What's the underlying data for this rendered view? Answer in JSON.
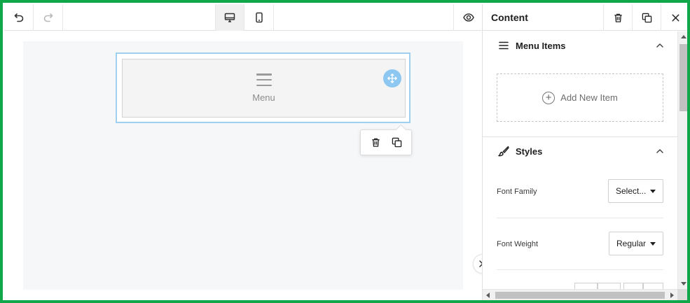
{
  "toolbar": {
    "undo_icon": "undo-icon",
    "redo_icon": "redo-icon",
    "desktop_icon": "desktop-icon",
    "mobile_icon": "mobile-icon",
    "preview_icon": "eye-icon"
  },
  "canvas": {
    "menu_label": "Menu"
  },
  "panel": {
    "title": "Content",
    "sections": {
      "menu_items": {
        "title": "Menu Items",
        "add_label": "Add New Item"
      },
      "styles": {
        "title": "Styles",
        "font_family_label": "Font Family",
        "font_family_value": "Select...",
        "font_weight_label": "Font Weight",
        "font_weight_value": "Regular"
      }
    }
  },
  "colors": {
    "frame_border": "#10a74a",
    "selection_outline": "#9fd0f0",
    "move_handle": "#8cc8f0",
    "canvas_bg": "#f6f7f9"
  }
}
